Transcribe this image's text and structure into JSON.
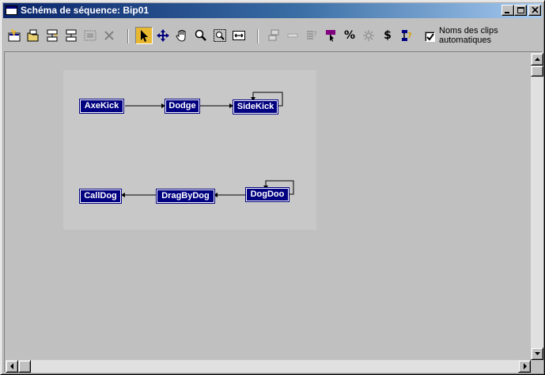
{
  "window": {
    "title": "Schéma de séquence: Bip01",
    "title_bar_color": "#0a246a"
  },
  "toolbar": {
    "buttons": [
      {
        "name": "insert-clip-icon",
        "enabled": true
      },
      {
        "name": "open-clip-icon",
        "enabled": true
      },
      {
        "name": "insert-transition-icon",
        "enabled": true
      },
      {
        "name": "set-start-clip-icon",
        "enabled": true
      },
      {
        "name": "swap-clips-icon",
        "enabled": false
      },
      {
        "name": "delete-icon",
        "enabled": false
      },
      {
        "name": "select-arrow-icon",
        "enabled": true,
        "active": true
      },
      {
        "name": "move-icon",
        "enabled": true
      },
      {
        "name": "pan-hand-icon",
        "enabled": true
      },
      {
        "name": "zoom-icon",
        "enabled": true
      },
      {
        "name": "zoom-region-icon",
        "enabled": true
      },
      {
        "name": "zoom-extents-icon",
        "enabled": true
      },
      {
        "name": "clip-properties-icon",
        "enabled": false
      },
      {
        "name": "transition-icon",
        "enabled": false
      },
      {
        "name": "transition-editor-icon",
        "enabled": false
      },
      {
        "name": "select-random-icon",
        "enabled": true
      },
      {
        "name": "percent-icon",
        "enabled": true,
        "text": "%"
      },
      {
        "name": "random-start-icon",
        "enabled": false
      },
      {
        "name": "dollar-icon",
        "enabled": true,
        "text": "$"
      },
      {
        "name": "compute-path-icon",
        "enabled": true
      }
    ],
    "auto_clip_names": {
      "checked": true,
      "label": "Noms des clips automatiques"
    }
  },
  "diagram": {
    "clips": [
      {
        "id": "axekick",
        "label": "AxeKick",
        "style": "start"
      },
      {
        "id": "dodge",
        "label": "Dodge"
      },
      {
        "id": "sidekick",
        "label": "SideKick",
        "self_loop": true
      },
      {
        "id": "calldog",
        "label": "CallDog"
      },
      {
        "id": "dragbydog",
        "label": "DragByDog"
      },
      {
        "id": "dogdoo",
        "label": "DogDoo",
        "self_loop": true
      }
    ],
    "transitions": [
      {
        "from": "axekick",
        "to": "dodge"
      },
      {
        "from": "dodge",
        "to": "sidekick"
      },
      {
        "from": "sidekick",
        "to": "sidekick"
      },
      {
        "from": "dogdoo",
        "to": "dragbydog"
      },
      {
        "from": "dragbydog",
        "to": "calldog"
      },
      {
        "from": "dogdoo",
        "to": "dogdoo"
      }
    ],
    "clip_color": "#000080"
  }
}
